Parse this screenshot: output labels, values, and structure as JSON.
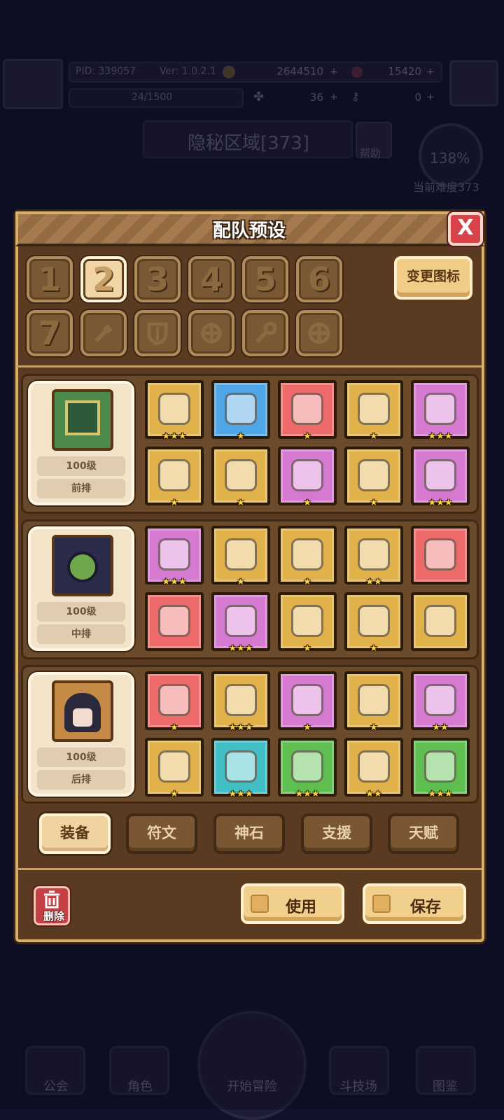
{
  "hud": {
    "pid": "PID: 339057",
    "version": "Ver: 1.0.2.1",
    "gold": "2644510",
    "gems": "15420",
    "energy": "24/1500",
    "clover": "36",
    "keys": "0",
    "area": "隐秘区域[373]",
    "help": "帮助",
    "percent": "138%",
    "difficulty": "当前难度373"
  },
  "bottom_nav": [
    "公会",
    "角色",
    "开始冒险",
    "斗技场",
    "图鉴"
  ],
  "dialog": {
    "title": "配队预设",
    "close": "X",
    "change_icon": "变更图标",
    "presets": [
      {
        "label": "1",
        "selected": false
      },
      {
        "label": "2",
        "selected": true
      },
      {
        "label": "3",
        "selected": false
      },
      {
        "label": "4",
        "selected": false
      },
      {
        "label": "5",
        "selected": false
      },
      {
        "label": "6",
        "selected": false
      },
      {
        "label": "7",
        "selected": false
      },
      {
        "icon": "sword-icon",
        "selected": false
      },
      {
        "icon": "shield-icon",
        "selected": false
      },
      {
        "icon": "crosshair-icon",
        "selected": false
      },
      {
        "icon": "staff-icon",
        "selected": false
      },
      {
        "icon": "cross-icon",
        "selected": false
      }
    ],
    "heroes": [
      {
        "level": "100级",
        "position": "前排",
        "items": [
          {
            "icon": "flame-sword-icon",
            "quality": "gold",
            "stars": "★★★"
          },
          {
            "icon": "shell-icon",
            "quality": "blue",
            "stars": "★"
          },
          {
            "icon": "plaid-pendant-icon",
            "quality": "red",
            "stars": "★"
          },
          {
            "icon": "ruby-plate-icon",
            "quality": "gold",
            "stars": "★"
          },
          {
            "icon": "crystal-ring-icon",
            "quality": "purple",
            "stars": "★★★"
          },
          {
            "icon": "horned-helmet-icon",
            "quality": "gold",
            "stars": "★"
          },
          {
            "icon": "golden-armor-icon",
            "quality": "gold",
            "stars": "★"
          },
          {
            "icon": "ice-scroll-icon",
            "quality": "purple",
            "stars": "★"
          },
          {
            "icon": "jade-ring-icon",
            "quality": "gold",
            "stars": "★"
          },
          {
            "icon": "leather-boots-icon",
            "quality": "purple",
            "stars": "★★★"
          }
        ]
      },
      {
        "level": "100级",
        "position": "中排",
        "items": [
          {
            "icon": "magic-wand-icon",
            "quality": "purple",
            "stars": "★★★"
          },
          {
            "icon": "holy-shield-icon",
            "quality": "gold",
            "stars": "★"
          },
          {
            "icon": "heart-necklace-icon",
            "quality": "gold",
            "stars": "★"
          },
          {
            "icon": "blue-rose-icon",
            "quality": "gold",
            "stars": "★★"
          },
          {
            "icon": "gold-ring-icon",
            "quality": "red",
            "stars": ""
          },
          {
            "icon": "straw-hat-icon",
            "quality": "red",
            "stars": ""
          },
          {
            "icon": "dark-armor-icon",
            "quality": "purple",
            "stars": "★★★"
          },
          {
            "icon": "winged-gem-icon",
            "quality": "gold",
            "stars": "★"
          },
          {
            "icon": "tiara-icon",
            "quality": "gold",
            "stars": "★"
          },
          {
            "icon": "ice-boots-icon",
            "quality": "gold",
            "stars": ""
          }
        ]
      },
      {
        "level": "100级",
        "position": "后排",
        "items": [
          {
            "icon": "wooden-staff-icon",
            "quality": "red",
            "stars": "★"
          },
          {
            "icon": "crossed-swords-icon",
            "quality": "gold",
            "stars": "★★★"
          },
          {
            "icon": "heart-choker-icon",
            "quality": "purple",
            "stars": "★"
          },
          {
            "icon": "gem-brooch-icon",
            "quality": "gold",
            "stars": "★"
          },
          {
            "icon": "diamond-ring-icon",
            "quality": "purple",
            "stars": "★★"
          },
          {
            "icon": "green-hat-icon",
            "quality": "gold",
            "stars": "★"
          },
          {
            "icon": "chain-mail-icon",
            "quality": "teal",
            "stars": "★★★"
          },
          {
            "icon": "bandage-icon",
            "quality": "green",
            "stars": "★★★"
          },
          {
            "icon": "eye-amulet-icon",
            "quality": "gold",
            "stars": "★★"
          },
          {
            "icon": "iron-boots-icon",
            "quality": "green",
            "stars": "★★★"
          }
        ]
      }
    ],
    "tabs": [
      {
        "label": "装备",
        "active": true
      },
      {
        "label": "符文",
        "active": false
      },
      {
        "label": "神石",
        "active": false
      },
      {
        "label": "支援",
        "active": false
      },
      {
        "label": "天赋",
        "active": false
      }
    ],
    "delete_label": "删除",
    "use_label": "使用",
    "save_label": "保存"
  },
  "colors": {
    "gold": "#e2b24a",
    "purple": "#d67ad1",
    "red": "#ee6a6a",
    "blue": "#4fa6e6",
    "teal": "#41bfc4",
    "green": "#5ebf50"
  }
}
